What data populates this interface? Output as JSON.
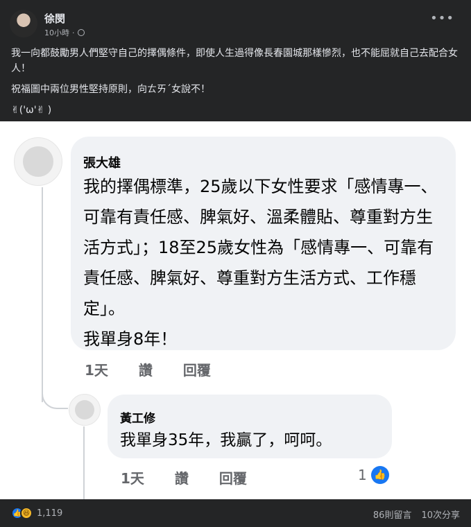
{
  "post": {
    "author": "徐閔",
    "time": "10小時",
    "more": "•••",
    "lines": [
      "我一向都鼓勵男人們堅守自己的擇偶條件，即使人生過得像長春園城那樣慘烈，也不能屈就自己去配合女人！",
      "祝福圖中兩位男性堅持原則，向ㄊㄞˊ女說不！",
      "✌('ω'✌ )"
    ]
  },
  "comment1": {
    "name": "張大雄",
    "text": "我的擇偶標準，25歲以下女性要求「感情專一、可靠有責任感、脾氣好、溫柔體貼、尊重對方生活方式」；18至25歲女性為「感情專一、可靠有責任感、脾氣好、尊重對方生活方式、工作穩定」。\n我單身8年！",
    "actions": [
      "1天",
      "讚",
      "回覆"
    ]
  },
  "comment2": {
    "name": "黃工修",
    "text": "我單身35年，我贏了，呵呵。",
    "actions": [
      "1天",
      "讚",
      "回覆"
    ],
    "likes": "1"
  },
  "footer": {
    "reactions": "1,119",
    "comments": "86則留言",
    "shares": "10次分享"
  },
  "icons": {
    "like": "thumbs-up-icon",
    "haha": "haha-icon",
    "globe": "globe-icon",
    "more": "more-icon"
  },
  "colors": {
    "bg": "#242526",
    "accent": "#1877f2",
    "bubble": "#f0f2f5"
  }
}
